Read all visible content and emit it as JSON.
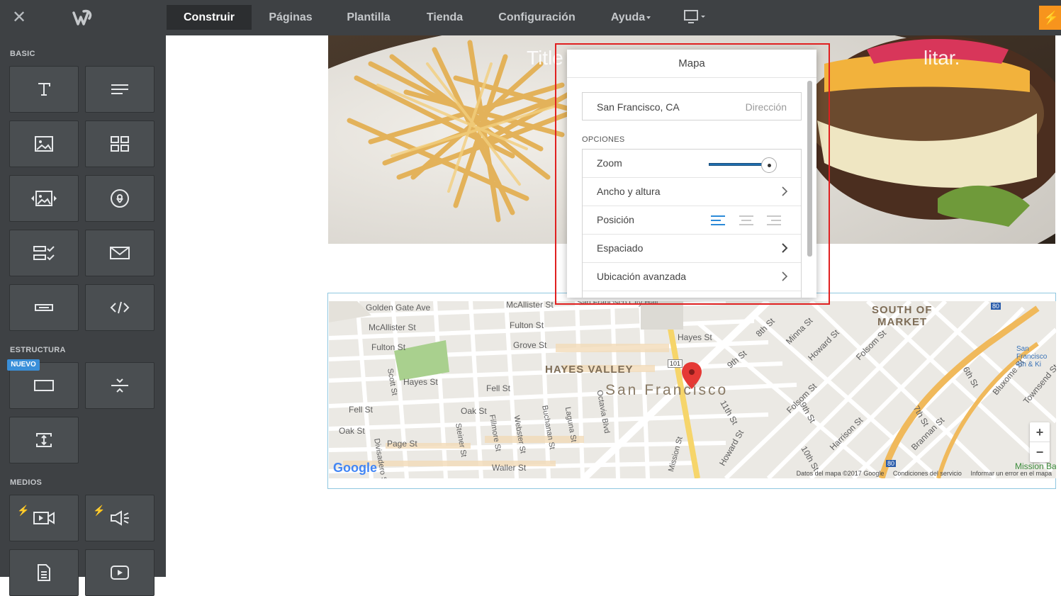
{
  "topbar": {
    "close_icon": "close-icon",
    "logo_icon": "weebly-logo",
    "nav": {
      "construir": "Construir",
      "paginas": "Páginas",
      "plantilla": "Plantilla",
      "tienda": "Tienda",
      "configuracion": "Configuración",
      "ayuda": "Ayuda"
    },
    "device_icon": "monitor-icon",
    "upgrade_icon": "bolt-icon",
    "accent_color": "#f7941d"
  },
  "sidebar": {
    "sections": {
      "basic": "BASIC",
      "estructura": "ESTRUCTURA",
      "medios": "MEDIOS"
    },
    "badge_nuevo": "NUEVO",
    "tiles": {
      "basic": [
        "title-icon",
        "text-icon",
        "image-icon",
        "gallery-icon",
        "slideshow-icon",
        "map-icon",
        "form-icon",
        "contact-form-icon",
        "button-icon",
        "embed-code-icon"
      ],
      "estructura": [
        "section-icon",
        "divider-icon",
        "spacer-icon"
      ],
      "medios": [
        "video-icon",
        "audio-icon",
        "document-icon",
        "youtube-icon"
      ]
    }
  },
  "hero": {
    "title_start": "Title",
    "title_end": "litar."
  },
  "panel": {
    "title": "Mapa",
    "address_value": "San Francisco, CA",
    "address_placeholder": "Dirección",
    "options_label": "OPCIONES",
    "options": {
      "zoom": "Zoom",
      "ancho": "Ancho y altura",
      "posicion": "Posición",
      "espaciado": "Espaciado",
      "ubicacion": "Ubicación avanzada"
    },
    "zoom_level": 0.85,
    "position_selected": "left"
  },
  "map": {
    "city": "San Francisco",
    "hayes_valley": "HAYES VALLEY",
    "south_of_market_1": "SOUTH OF",
    "south_of_market_2": "MARKET",
    "streets": {
      "golden_gate": "Golden Gate Ave",
      "mcallister": "McAllister St",
      "mcallister2": "McAllister St",
      "fulton": "Fulton St",
      "fulton2": "Fulton St",
      "grove": "Grove St",
      "hayes": "Hayes St",
      "hayes2": "Hayes St",
      "fell": "Fell St",
      "fell2": "Fell St",
      "oak": "Oak St",
      "oak2": "Oak St",
      "page": "Page St",
      "waller": "Waller St",
      "scott": "Scott St",
      "divisadero": "Divisadero St",
      "steiner": "Steiner St",
      "fillmore": "Fillmore St",
      "webster": "Webster St",
      "buchanan": "Buchanan St",
      "laguna": "Laguna St",
      "octavia": "Octavia Blvd",
      "mission": "Mission St",
      "howard": "Howard St",
      "folsom": "Folsom St",
      "harrison": "Harrison St",
      "bryant": "Brannan St",
      "minna": "Minna St",
      "eighth": "8th St",
      "ninth": "9th St",
      "ninth2": "9th St",
      "tenth": "10th St",
      "eleventh": "11th St",
      "sixth": "6th St",
      "seventh": "7th St",
      "bluxome": "Bluxome St",
      "townsend": "Townsend St",
      "sf_4th": "San Francisco 4th & Ki",
      "city_hall": "San Francisco City Hall",
      "mission_bay": "Mission Bay",
      "hwy101": "101",
      "i80": "80",
      "i80b": "80"
    },
    "google": "Google",
    "footer_data": "Datos del mapa ©2017 Google",
    "footer_terms": "Condiciones del servicio",
    "footer_report": "Informar un error en el mapa",
    "zoom_in": "+",
    "zoom_out": "−"
  }
}
